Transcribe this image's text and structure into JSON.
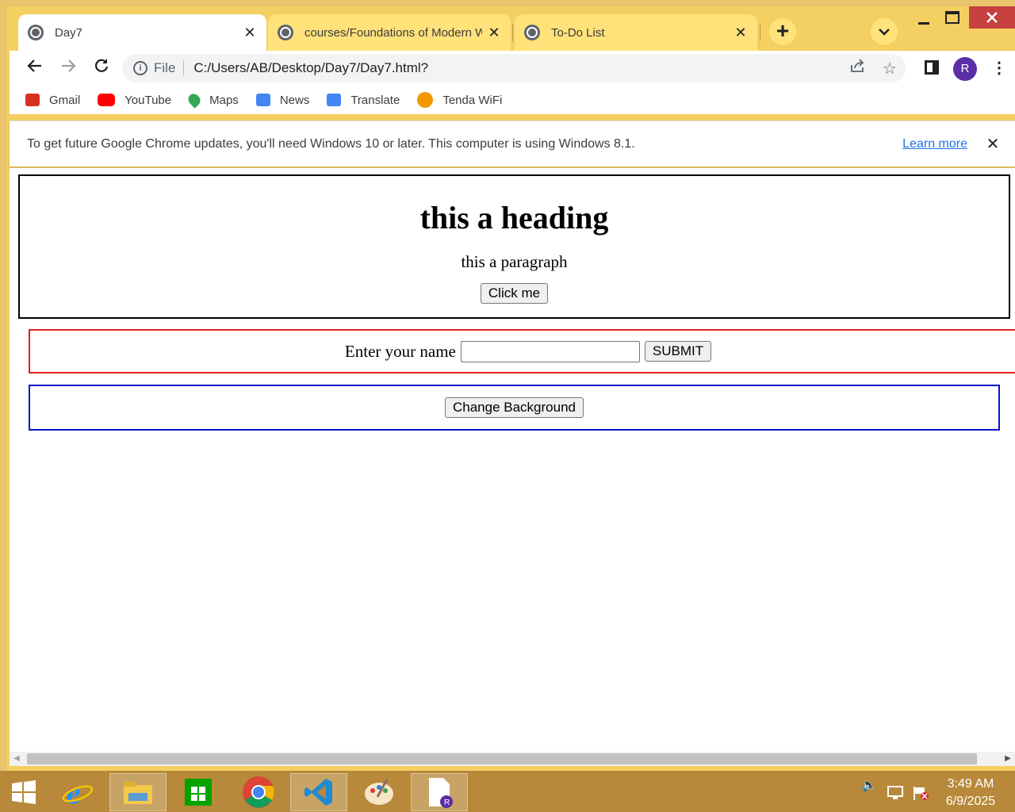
{
  "browser": {
    "tabs": [
      {
        "title": "Day7",
        "active": true
      },
      {
        "title": "courses/Foundations of Modern W",
        "active": false
      },
      {
        "title": "To-Do List",
        "active": false
      }
    ],
    "new_tab_symbol": "+",
    "address": {
      "scheme": "File",
      "url": "C:/Users/AB/Desktop/Day7/Day7.html?"
    },
    "profile_initial": "R",
    "bookmarks": [
      {
        "label": "Gmail",
        "icon": "gmail-icon",
        "color": "#d93025"
      },
      {
        "label": "YouTube",
        "icon": "youtube-icon",
        "color": "#ff0000"
      },
      {
        "label": "Maps",
        "icon": "maps-icon",
        "color": "#34a853"
      },
      {
        "label": "News",
        "icon": "news-icon",
        "color": "#4285f4"
      },
      {
        "label": "Translate",
        "icon": "translate-icon",
        "color": "#4285f4"
      },
      {
        "label": "Tenda WiFi",
        "icon": "tenda-icon",
        "color": "#f29900"
      }
    ],
    "infobar": {
      "message": "To get future Google Chrome updates, you'll need Windows 10 or later. This computer is using Windows 8.1.",
      "link": "Learn more"
    }
  },
  "page": {
    "heading": "this a heading",
    "paragraph": "this a paragraph",
    "click_button": "Click me",
    "name_label": "Enter your name",
    "name_value": "",
    "submit_button": "SUBMIT",
    "change_bg_button": "Change Background",
    "colors": {
      "box1_border": "#000000",
      "box2_border": "#e02020",
      "box3_border": "#0a14c8"
    }
  },
  "taskbar": {
    "apps": [
      "windows-start-icon",
      "internet-explorer-icon",
      "file-explorer-icon",
      "store-icon",
      "chrome-icon",
      "vscode-icon",
      "paint-icon",
      "file-icon"
    ],
    "time": "3:49 AM",
    "date": "6/9/2025"
  }
}
